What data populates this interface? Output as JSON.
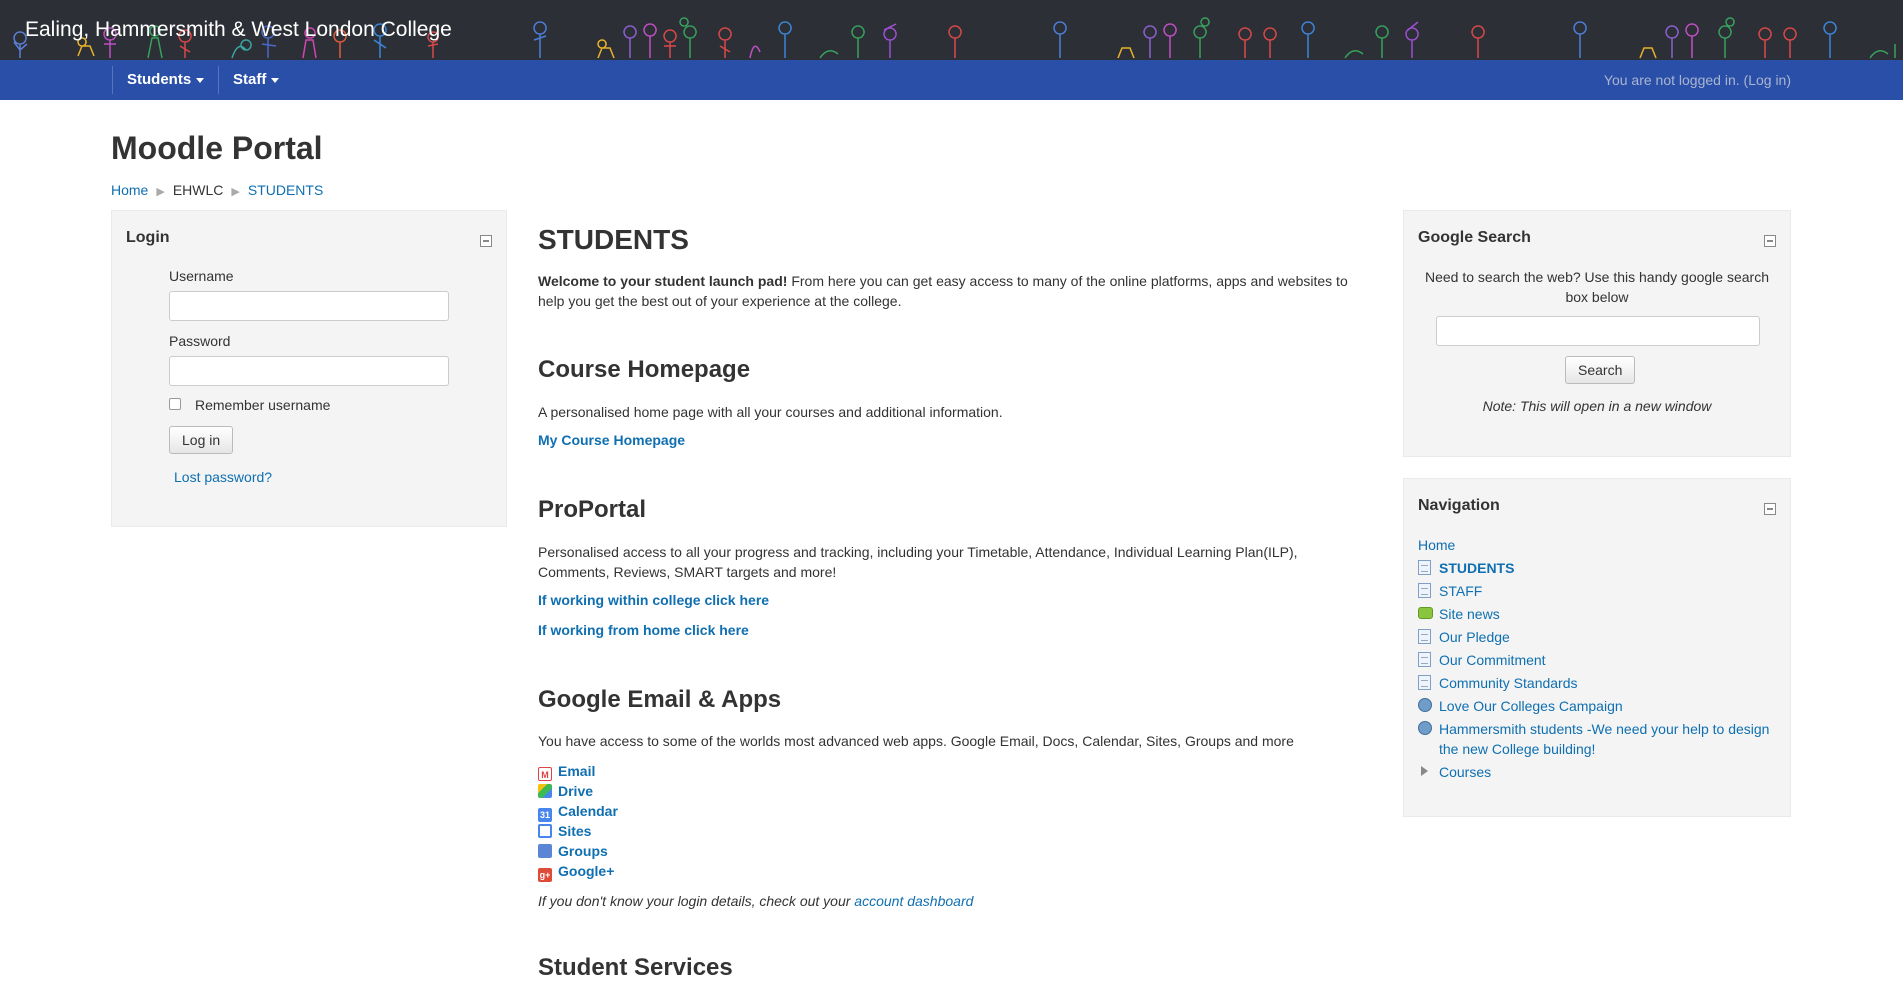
{
  "header": {
    "site_title": "Ealing, Hammersmith & West London College",
    "nav": [
      {
        "label": "Students"
      },
      {
        "label": "Staff"
      }
    ],
    "login_status": "You are not logged in.",
    "login_link": "(Log in)"
  },
  "page": {
    "title": "Moodle Portal",
    "breadcrumb": [
      "Home",
      "EHWLC",
      "STUDENTS"
    ]
  },
  "login_block": {
    "title": "Login",
    "username_label": "Username",
    "username_value": "",
    "password_label": "Password",
    "password_value": "",
    "remember_label": "Remember username",
    "remember_checked": false,
    "login_button": "Log in",
    "lost_password": "Lost password?"
  },
  "main": {
    "title": "STUDENTS",
    "intro_bold": "Welcome to your student launch pad!",
    "intro_rest": " From here you can get easy access to many of the online platforms, apps and websites to help you get the best out of your experience at the college.",
    "course": {
      "heading": "Course Homepage",
      "desc": "A personalised home page with all your courses and additional information.",
      "link": "My Course Homepage"
    },
    "proportal": {
      "heading": "ProPortal",
      "desc": "Personalised access to all your progress and tracking, including your Timetable, Attendance, Individual Learning Plan(ILP), Comments, Reviews, SMART targets and more!",
      "link1": "If working within college click here",
      "link2": "If working from home click here"
    },
    "google": {
      "heading": "Google Email & Apps",
      "desc": "You have access to some of the worlds most advanced web apps. Google Email, Docs, Calendar, Sites, Groups and more",
      "apps": [
        {
          "label": "Email",
          "icon": "gmail-icon"
        },
        {
          "label": "Drive",
          "icon": "drive-icon"
        },
        {
          "label": "Calendar",
          "icon": "calendar-icon"
        },
        {
          "label": "Sites",
          "icon": "sites-icon"
        },
        {
          "label": "Groups",
          "icon": "groups-icon"
        },
        {
          "label": "Google+",
          "icon": "google-plus-icon"
        }
      ],
      "note_prefix": "If you don't know your login details, check out your ",
      "note_link": "account dashboard"
    },
    "next_heading": "Student Services"
  },
  "google_search": {
    "title": "Google Search",
    "desc": "Need to search the web? Use this handy google search box below",
    "input_value": "",
    "button": "Search",
    "note": "Note: This will open in a new window"
  },
  "navigation": {
    "title": "Navigation",
    "home": "Home",
    "items": [
      {
        "label": "STUDENTS",
        "icon": "page-icon",
        "bold": true
      },
      {
        "label": "STAFF",
        "icon": "page-icon"
      },
      {
        "label": "Site news",
        "icon": "forum-icon"
      },
      {
        "label": "Our Pledge",
        "icon": "page-icon"
      },
      {
        "label": "Our Commitment",
        "icon": "page-icon"
      },
      {
        "label": "Community Standards",
        "icon": "page-icon"
      },
      {
        "label": "Love Our Colleges Campaign",
        "icon": "url-icon"
      },
      {
        "label": "Hammersmith students -We need your help to design the new College building!",
        "icon": "url-icon"
      },
      {
        "label": "Courses",
        "icon": "expand-arrow-icon"
      }
    ]
  },
  "colors": {
    "header_bg": "#2c3036",
    "navbar_bg": "#2a4fa8",
    "link": "#0f6fb1",
    "block_bg": "#f4f4f4"
  }
}
